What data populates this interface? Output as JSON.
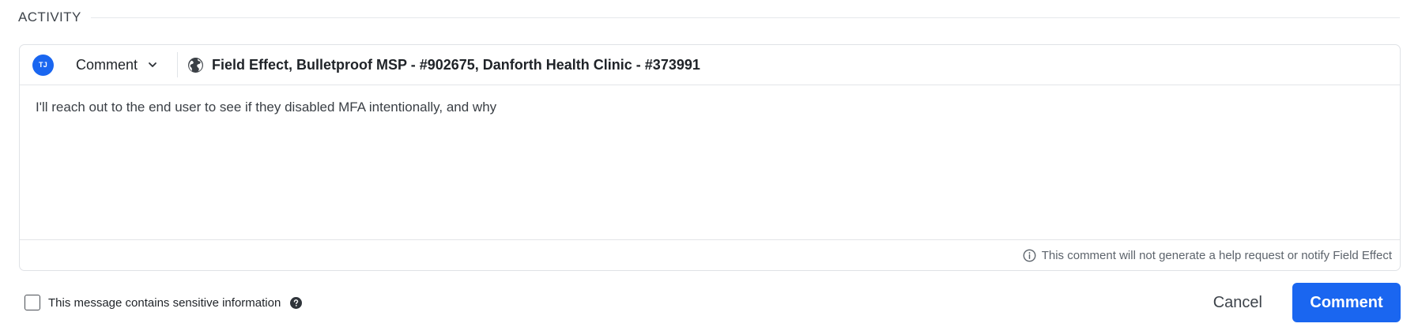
{
  "section": {
    "title": "ACTIVITY"
  },
  "composer": {
    "avatar_initials": "TJ",
    "type_label": "Comment",
    "audience": "Field Effect, Bulletproof MSP - #902675, Danforth Health Clinic - #373991",
    "body_text": "I'll reach out to the end user to see if they disabled MFA intentionally, and why",
    "footer_note": "This comment will not generate a help request or notify Field Effect"
  },
  "sensitive": {
    "label": "This message contains sensitive information",
    "checked": false
  },
  "actions": {
    "cancel_label": "Cancel",
    "submit_label": "Comment"
  },
  "colors": {
    "accent": "#1a66f0",
    "border": "#dfe2e6",
    "muted_text": "#5d646c"
  },
  "icons": {
    "type_dropdown": "chevron-down-icon",
    "audience": "globe-icon",
    "footer": "info-icon",
    "sensitive_help": "help-icon"
  }
}
